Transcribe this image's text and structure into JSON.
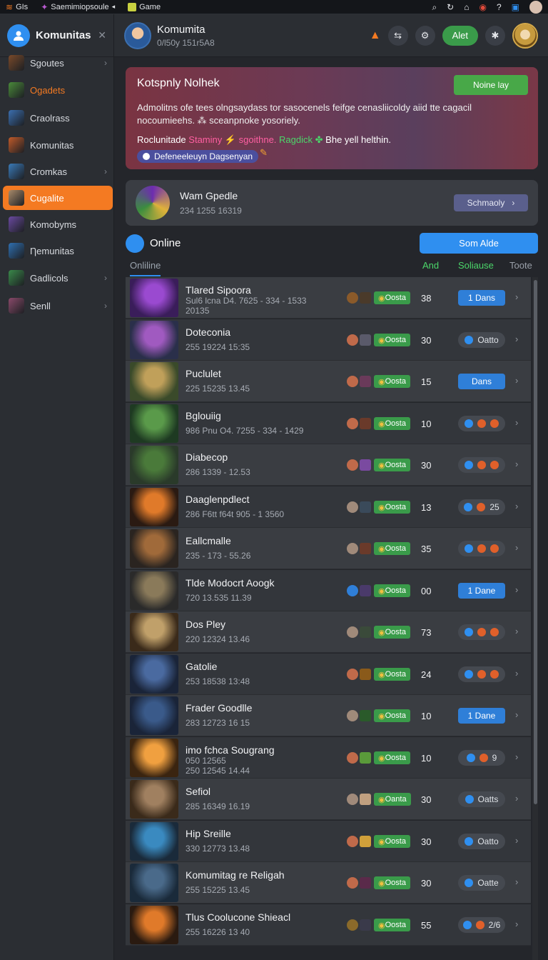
{
  "topbar": {
    "items": [
      {
        "label": "GIs",
        "icon": "flame-icon"
      },
      {
        "label": "Saemimiopsoule",
        "icon": "game-app-icon"
      },
      {
        "label": "Game",
        "icon": "game-icon"
      }
    ]
  },
  "sidebar": {
    "title": "Komunitas",
    "items": [
      {
        "label": "Sgoutes",
        "chevron": true,
        "state": "normal",
        "color": "#7a4a2a"
      },
      {
        "label": "Ogadets",
        "chevron": false,
        "state": "accent",
        "color": "#4a8a3a"
      },
      {
        "label": "Craolrass",
        "chevron": false,
        "state": "normal",
        "color": "#3b6fb0"
      },
      {
        "label": "Komunitas",
        "chevron": false,
        "state": "normal",
        "color": "#c05a2a"
      },
      {
        "label": "Cromkas",
        "chevron": true,
        "state": "normal",
        "color": "#3a7ab8"
      },
      {
        "label": "Cugalite",
        "chevron": false,
        "state": "active",
        "color": "#a88a6a"
      },
      {
        "label": "Komobyms",
        "chevron": false,
        "state": "normal",
        "color": "#6a4aa0"
      },
      {
        "label": "Ƞemunitas",
        "chevron": false,
        "state": "normal",
        "color": "#2f6fb0"
      },
      {
        "label": "Gadlicols",
        "chevron": true,
        "state": "normal",
        "color": "#3a8a4a"
      },
      {
        "label": "Senll",
        "chevron": true,
        "state": "normal",
        "color": "#8a4a6a"
      }
    ]
  },
  "header": {
    "name": "Komumita",
    "sub": "0/l50y 151r5A8",
    "alert_label": "Alet"
  },
  "notice": {
    "title": "Kotspnly Nolhek",
    "button": "Noine lay",
    "text": "Admolitns ofe tees olngsaydass tor sasocenels feifge cenasliicoldy aiid tte cagacil nocoumieehs. ⁂ sceanpnoke yosoriely.",
    "line_prefix": "Roclunitade",
    "line_pink": "Staminy ⚡ sgoithne.",
    "line_green": "Ragdick",
    "line_suffix": "Bhe yell helthin.",
    "pill": "Defeneeleuyn Dagsenyan"
  },
  "gamecard": {
    "title": "Wam Gpedle",
    "sub": "234 1255 16319",
    "button": "Schmaoly"
  },
  "online": {
    "title": "Online",
    "button": "Som Alde",
    "tab": "Onliline",
    "col_and": "And",
    "col_solause": "Soliause",
    "col_toote": "Toote"
  },
  "rows": [
    {
      "title": "Tlared Sipoora",
      "sub": "Sul6 lcna D4. 7625 - 334 - 1533",
      "sub2": "20135",
      "tag": "Oosta",
      "tag_color": "#3a9b4a",
      "num": "38",
      "action": "1 Dans",
      "action_style": "primary",
      "bg": "alt",
      "thumb": [
        "#3a1d5a",
        "#9a4ad0"
      ],
      "b1": "#8a5a2a",
      "b2": "#4a3a2a"
    },
    {
      "title": "Doteconia",
      "sub": "255 19224 15:35",
      "sub2": "",
      "tag": "Oosta",
      "tag_color": "#3a9b4a",
      "num": "30",
      "action": "Oatto",
      "action_style": "plain",
      "bg": "norm",
      "thumb": [
        "#2a2f4a",
        "#a05ac0"
      ],
      "b1": "#c06a4a",
      "b2": "#5a5a6a"
    },
    {
      "title": "Puclulet",
      "sub": "225 15235 13.45",
      "sub2": "",
      "tag": "Oosta",
      "tag_color": "#3a9b4a",
      "num": "15",
      "action": "Dans",
      "action_style": "primary",
      "bg": "alt",
      "thumb": [
        "#3a4a2a",
        "#c0a05a"
      ],
      "b1": "#c06a4a",
      "b2": "#6a3a5a"
    },
    {
      "title": "Bglouiig",
      "sub": "986 Pnu O4. 7255 - 334 - 1429",
      "sub2": "",
      "tag": "Oosta",
      "tag_color": "#3a9b4a",
      "num": "10",
      "action": "",
      "action_style": "dots",
      "bg": "norm",
      "thumb": [
        "#1e3a22",
        "#5a9a4a"
      ],
      "b1": "#c06a4a",
      "b2": "#6a3a2a"
    },
    {
      "title": "Diabecop",
      "sub": "286 1339 - 12.53",
      "sub2": "",
      "tag": "Oosta",
      "tag_color": "#3a9b4a",
      "num": "30",
      "action": "",
      "action_style": "dots",
      "bg": "alt",
      "thumb": [
        "#2a3a2a",
        "#4a7a3a"
      ],
      "b1": "#c06a4a",
      "b2": "#7a4aa0"
    },
    {
      "title": "Daaglenpdlect",
      "sub": "286 F6tt f64t 905 - 1 3560",
      "sub2": "",
      "tag": "Oosta",
      "tag_color": "#3a9b4a",
      "num": "13",
      "action": "25",
      "action_style": "dots-num",
      "bg": "norm",
      "thumb": [
        "#2a1a12",
        "#e07a2a"
      ],
      "b1": "#a08a7a",
      "b2": "#3a4a5a"
    },
    {
      "title": "Eallcmalle",
      "sub": "235 - 173 - 55.26",
      "sub2": "",
      "tag": "Oosta",
      "tag_color": "#3a9b4a",
      "num": "35",
      "action": "",
      "action_style": "dots",
      "bg": "alt",
      "thumb": [
        "#2a2420",
        "#a06a3a"
      ],
      "b1": "#a08a7a",
      "b2": "#6a3a2a"
    },
    {
      "title": "Tlde Modocrt Aoogk",
      "sub": "720 13.535 11.39",
      "sub2": "",
      "tag": "Oosta",
      "tag_color": "#3a9b4a",
      "num": "00",
      "action": "1 Dane",
      "action_style": "primary",
      "bg": "norm",
      "thumb": [
        "#2a2a2a",
        "#8a7a5a"
      ],
      "b1": "#2f7fd8",
      "b2": "#4a3a6a"
    },
    {
      "title": "Dos Pley",
      "sub": "220 12324 13.46",
      "sub2": "",
      "tag": "Oosta",
      "tag_color": "#3a9b4a",
      "num": "73",
      "action": "",
      "action_style": "dots",
      "bg": "alt",
      "thumb": [
        "#3a2a1a",
        "#c0a06a"
      ],
      "b1": "#a08a7a",
      "b2": "#3a4a3a"
    },
    {
      "title": "Gatolie",
      "sub": "253 18538 13:48",
      "sub2": "",
      "tag": "Oosta",
      "tag_color": "#3a9b4a",
      "num": "24",
      "action": "",
      "action_style": "dots",
      "bg": "norm",
      "thumb": [
        "#1a2438",
        "#4a6aa0"
      ],
      "b1": "#c06a4a",
      "b2": "#8a5a1a"
    },
    {
      "title": "Frader Goodlle",
      "sub": "283 12723 16 15",
      "sub2": "",
      "tag": "Oosta",
      "tag_color": "#3a9b4a",
      "num": "10",
      "action": "1 Dane",
      "action_style": "primary",
      "bg": "alt",
      "thumb": [
        "#1a2438",
        "#3a5a8a"
      ],
      "b1": "#a08a7a",
      "b2": "#2a5a2a"
    },
    {
      "title": "imo fchca Sougrang",
      "sub": "050 12565",
      "sub2": "250 12545 14.44",
      "tag": "Oosta",
      "tag_color": "#3a9b4a",
      "num": "10",
      "action": "9",
      "action_style": "dots-num",
      "bg": "norm",
      "thumb": [
        "#3a2410",
        "#f0a040"
      ],
      "b1": "#c06a4a",
      "b2": "#5a9a3a"
    },
    {
      "title": "Sefiol",
      "sub": "285 16349 16.19",
      "sub2": "",
      "tag": "Oanta",
      "tag_color": "#3a9b4a",
      "num": "30",
      "action": "Oatts",
      "action_style": "plain",
      "bg": "alt",
      "thumb": [
        "#3a2a1a",
        "#a08060"
      ],
      "b1": "#a08a7a",
      "b2": "#c0a080"
    },
    {
      "title": "Hip Sreille",
      "sub": "330 12773 13.48",
      "sub2": "",
      "tag": "Oosta",
      "tag_color": "#3a9b4a",
      "num": "30",
      "action": "Oatto",
      "action_style": "plain",
      "bg": "norm",
      "thumb": [
        "#1a2a3a",
        "#3a8ac0"
      ],
      "b1": "#c06a4a",
      "b2": "#d0a03a"
    },
    {
      "title": "Komumitag re Religah",
      "sub": "255 15225 13.45",
      "sub2": "",
      "tag": "Oosta",
      "tag_color": "#3a9b4a",
      "num": "30",
      "action": "Oatte",
      "action_style": "plain",
      "bg": "alt",
      "thumb": [
        "#1a2a3a",
        "#4a6a8a"
      ],
      "b1": "#c06a4a",
      "b2": "#5a2a4a"
    },
    {
      "title": "Tlus Coolucone Shieacl",
      "sub": "255 16226 13 40",
      "sub2": "",
      "tag": "Oosta",
      "tag_color": "#3a9b4a",
      "num": "55",
      "action": "2/6",
      "action_style": "dots-num",
      "bg": "norm",
      "thumb": [
        "#2a1a10",
        "#e07a2a"
      ],
      "b1": "#8a6a2a",
      "b2": "#3a3a4a"
    }
  ]
}
